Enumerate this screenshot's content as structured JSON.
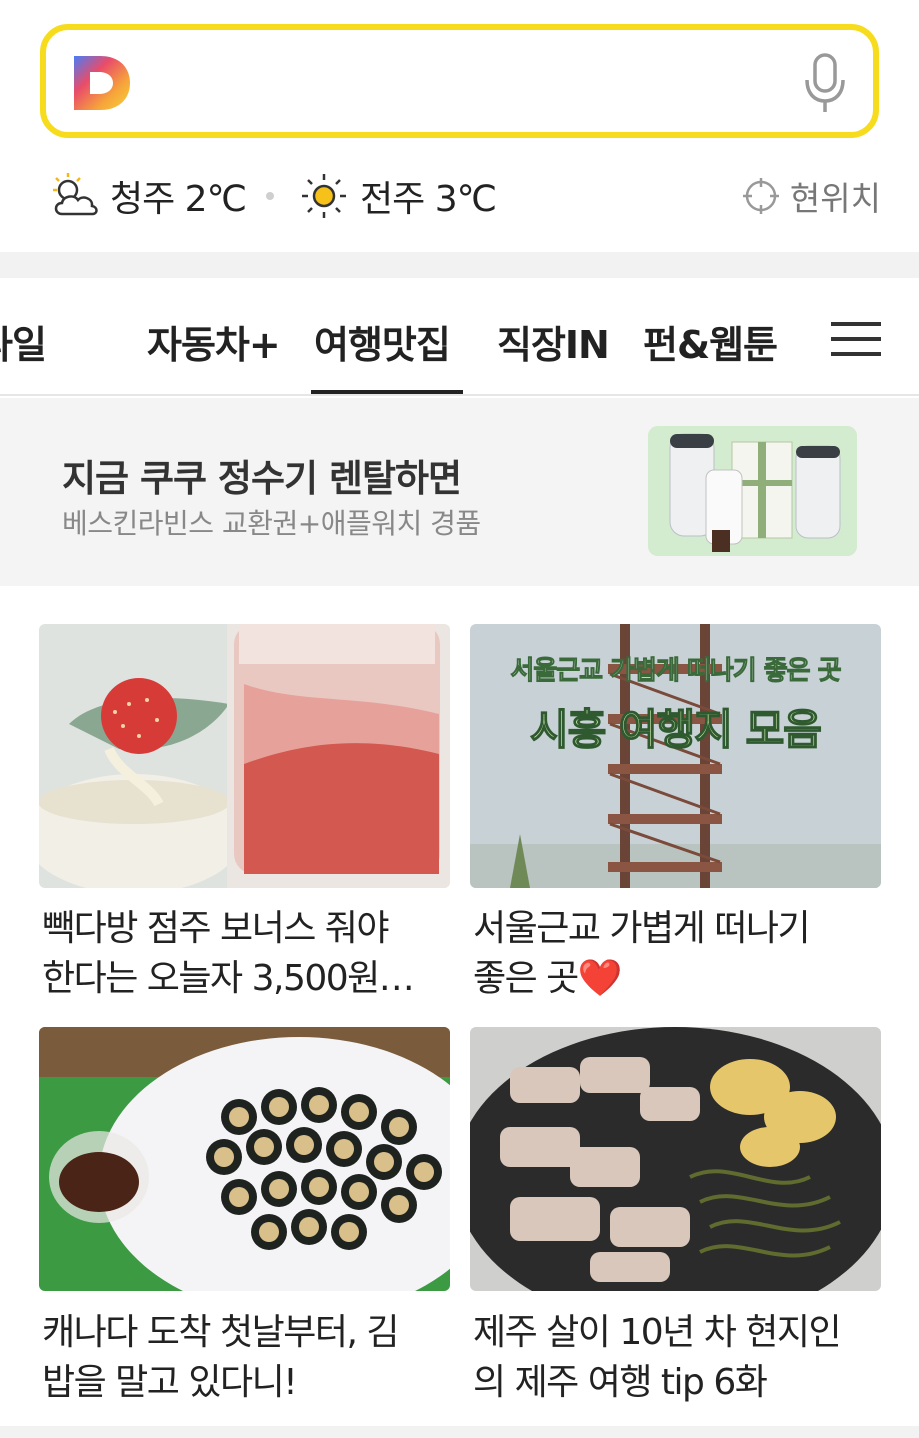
{
  "search": {
    "logo": "daum-logo",
    "mic_icon": "microphone-icon"
  },
  "weather": {
    "city1": "청주 2℃",
    "city1_icon": "partly-cloudy-icon",
    "city2": "전주 3℃",
    "city2_icon": "sun-icon",
    "location_label": "현위치",
    "location_icon": "crosshair-icon"
  },
  "tabs": [
    {
      "label": "타일"
    },
    {
      "label": "자동차+"
    },
    {
      "label": "여행맛집",
      "active": true
    },
    {
      "label": "직장IN"
    },
    {
      "label": "펀&웹툰"
    }
  ],
  "tab_menu_icon": "hamburger-menu-icon",
  "ad": {
    "title": "지금 쿠쿠 정수기 렌탈하면",
    "subtitle": "베스킨라빈스 교환권+애플워치 경품"
  },
  "cards": [
    {
      "title_line1": "빽다방 점주 보너스 줘야",
      "title_line2": "한다는 오늘자 3,500원…"
    },
    {
      "title_line1": "서울근교 가볍게 떠나기",
      "title_line2": "좋은 곳❤️",
      "image_caption_top": "서울근교 가볍게 떠나기 좋은 곳",
      "image_caption_main": "시흥 여행지 모음"
    },
    {
      "title_line1": "캐나다 도착 첫날부터, 김",
      "title_line2": "밥을 말고 있다니!"
    },
    {
      "title_line1": "제주 살이 10년 차 현지인",
      "title_line2": "의 제주 여행 tip 6화"
    }
  ],
  "colors": {
    "search_border": "#f6dc1c",
    "tab_indicator": "#222222"
  }
}
